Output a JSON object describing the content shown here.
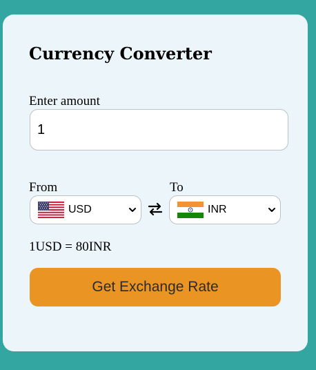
{
  "title": "Currency Converter",
  "amount": {
    "label": "Enter amount",
    "value": "1"
  },
  "from": {
    "label": "From",
    "selected": "USD",
    "flag_icon": "us-flag-icon"
  },
  "to": {
    "label": "To",
    "selected": "INR",
    "flag_icon": "india-flag-icon"
  },
  "swap_icon": "swap-arrows-icon",
  "rate_text": "1USD = 80INR",
  "button": {
    "label": "Get Exchange Rate"
  },
  "colors": {
    "page_background": "#33a6a2",
    "card_background": "#ecf5f9",
    "button_background": "#ea9424"
  }
}
